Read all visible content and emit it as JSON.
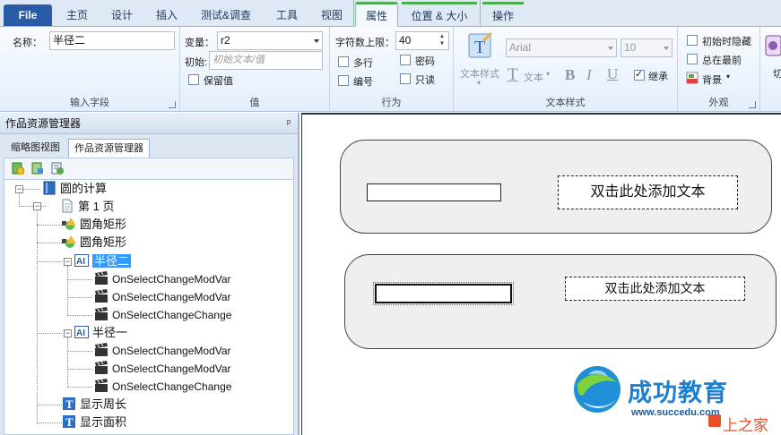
{
  "tabs": [
    {
      "label": "File"
    },
    {
      "label": "主页"
    },
    {
      "label": "设计"
    },
    {
      "label": "插入"
    },
    {
      "label": "测试&调查"
    },
    {
      "label": "工具"
    },
    {
      "label": "视图"
    },
    {
      "label": "属性"
    },
    {
      "label": "位置 & 大小"
    },
    {
      "label": "操作"
    }
  ],
  "ribbon": {
    "input_group": {
      "name_label": "名称：",
      "name_value": "半径二",
      "group_label": "输入字段"
    },
    "value_group": {
      "var_label": "变量：",
      "var_value": "r2",
      "init_label": "初始:",
      "init_placeholder": "初始文本/值",
      "keep_value": "保留值",
      "group_label": "值"
    },
    "behavior_group": {
      "maxchars_label": "字符数上限：",
      "maxchars_value": "40",
      "multiline": "多行",
      "password": "密码",
      "numbered": "编号",
      "readonly": "只读",
      "group_label": "行为"
    },
    "textstyle_group": {
      "textstyle_btn": "文本样式",
      "font": "Arial",
      "size": "10",
      "text_btn": "文本",
      "bold": "B",
      "italic": "I",
      "underline": "U",
      "inherit": "继承",
      "group_label": "文本样式"
    },
    "appearance_group": {
      "hide_initially": "初始时隐藏",
      "always_front": "总在最前",
      "background": "背景",
      "group_label": "外观"
    },
    "extra_label": "切"
  },
  "left_panel": {
    "title": "作品资源管理器",
    "pin": "ᵖ",
    "tabs": [
      {
        "label": "缩略图视图"
      },
      {
        "label": "作品资源管理器"
      }
    ],
    "tree": [
      {
        "label": "圆的计算"
      },
      {
        "label": "第 1 页"
      },
      {
        "label": "圆角矩形"
      },
      {
        "label": "圆角矩形"
      },
      {
        "label": "半径二"
      },
      {
        "label": "OnSelectChangeModVar"
      },
      {
        "label": "OnSelectChangeModVar"
      },
      {
        "label": "OnSelectChangeChange"
      },
      {
        "label": "半径一"
      },
      {
        "label": "OnSelectChangeModVar"
      },
      {
        "label": "OnSelectChangeModVar"
      },
      {
        "label": "OnSelectChangeChange"
      },
      {
        "label": "显示周长"
      },
      {
        "label": "显示面积"
      }
    ]
  },
  "canvas": {
    "textbox1": "双击此处添加文本",
    "textbox2": "双击此处添加文本"
  },
  "watermark": {
    "brand": "成功教育",
    "url": "www.succedu.com",
    "corner": "上之家"
  }
}
